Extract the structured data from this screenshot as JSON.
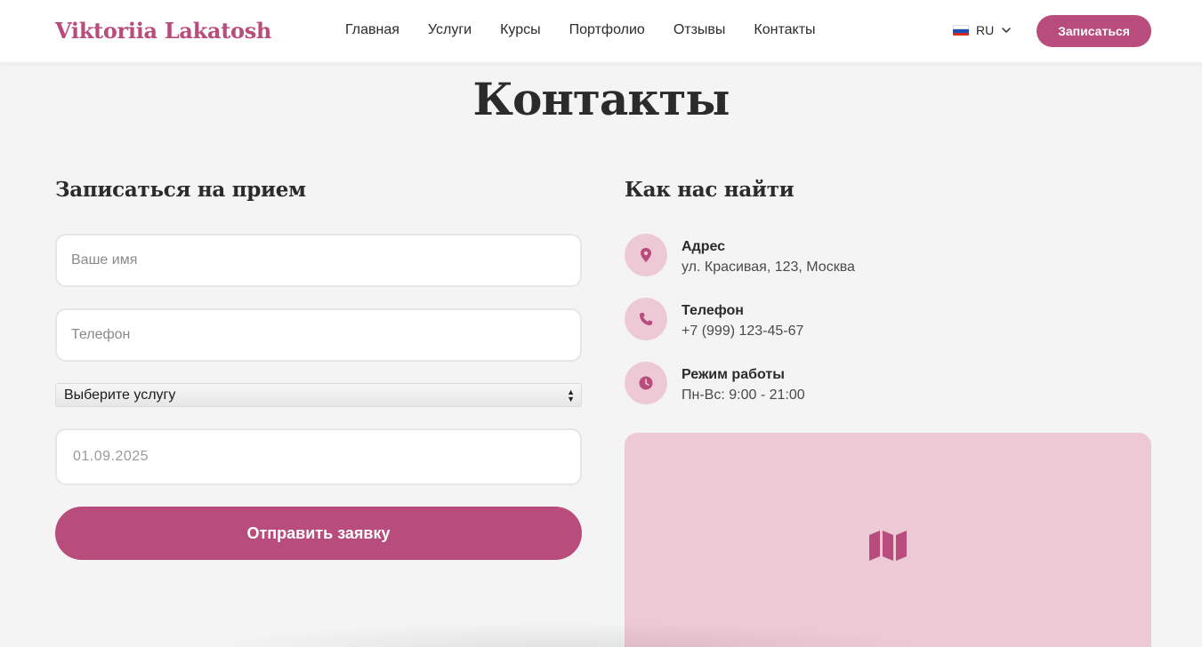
{
  "header": {
    "logo": "Viktoriia Lakatosh",
    "nav": [
      "Главная",
      "Услуги",
      "Курсы",
      "Портфолио",
      "Отзывы",
      "Контакты"
    ],
    "language": "RU",
    "cta_label": "Записаться"
  },
  "page": {
    "title": "Контакты"
  },
  "form": {
    "title": "Записаться на прием",
    "name_placeholder": "Ваше имя",
    "phone_placeholder": "Телефон",
    "service_selected": "Выберите услугу",
    "date_value": "01.09.2025",
    "submit_label": "Отправить заявку"
  },
  "contacts": {
    "title": "Как нас найти",
    "items": [
      {
        "label": "Адрес",
        "value": "ул. Красивая, 123, Москва",
        "icon": "map-pin-icon"
      },
      {
        "label": "Телефон",
        "value": "+7 (999) 123-45-67",
        "icon": "phone-icon"
      },
      {
        "label": "Режим работы",
        "value": "Пн-Вс: 9:00 - 21:00",
        "icon": "clock-icon"
      }
    ],
    "map_icon": "map-icon"
  },
  "colors": {
    "accent": "#b84c7c",
    "accent_light": "#ecc9d5",
    "background": "#f4f4f4"
  }
}
